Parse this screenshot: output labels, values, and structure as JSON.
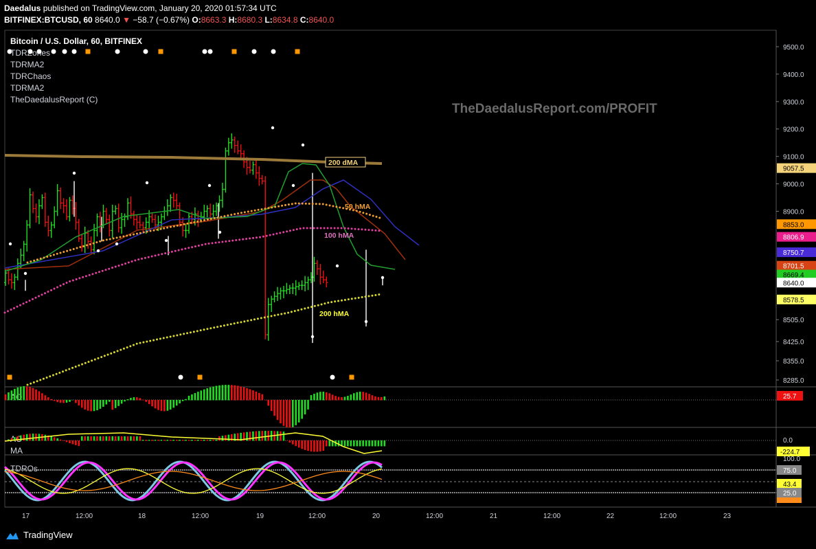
{
  "header": {
    "publisher": "Daedalus",
    "published_text": "published on TradingView.com, January 20, 2020 01:57:34 UTC",
    "symbol": "BITFINEX:BTCUSD, 60",
    "last": "8640.0",
    "change": "−58.7 (−0.67%)",
    "o_label": "O:",
    "o": "8663.3",
    "h_label": "H:",
    "h": "8680.3",
    "l_label": "L:",
    "l": "8634.8",
    "c_label": "C:",
    "c": "8640.0"
  },
  "legend": {
    "title": "Bitcoin / U.S. Dollar, 60, BITFINEX",
    "items": [
      "TDRZones",
      "TDRMA2",
      "TDRChaos",
      "TDRMA2",
      "TheDaedalusReport (C)"
    ]
  },
  "watermark": "TheDaedalusReport.com/PROFIT",
  "footer": {
    "brand": "TradingView"
  },
  "colors": {
    "up": "#22dd22",
    "down": "#ee1111",
    "ma200d": "#9c7a3a",
    "hma50": "#f0a030",
    "hma100": "#e040a0",
    "hma200": "#d8d830",
    "blue": "#3030c0",
    "green_ma": "#21a030",
    "brown_ma": "#a0300a"
  },
  "chart_data": [
    {
      "type": "line",
      "name": "price",
      "x_ticks": [
        "17",
        "12:00",
        "18",
        "12:00",
        "19",
        "12:00",
        "20",
        "12:00",
        "21",
        "12:00",
        "22",
        "12:00",
        "23"
      ],
      "y_ticks": [
        9500,
        9400,
        9300,
        9200,
        9100,
        9000,
        8900,
        8800,
        8700,
        8600,
        8505,
        8425,
        8355,
        8285
      ],
      "y_tick_labels": [
        "9500.0",
        "9400.0",
        "9300.0",
        "9200.0",
        "9100.0",
        "9000.0",
        "8900.0",
        "",
        "",
        "",
        "8505.0",
        "8425.0",
        "8355.0",
        "8285.0"
      ],
      "ylim": [
        8260,
        9560
      ],
      "price_tags": [
        {
          "label": "9057.5",
          "value": 9057.5,
          "color": "#f5d37a",
          "text": "#000"
        },
        {
          "label": "8853.0",
          "value": 8853.0,
          "color": "#ff9800",
          "text": "#000"
        },
        {
          "label": "8806.9",
          "value": 8806.9,
          "color": "#e91e8c",
          "text": "#fff"
        },
        {
          "label": "8750.7",
          "value": 8750.7,
          "color": "#4a2bd8",
          "text": "#fff"
        },
        {
          "label": "8701.5",
          "value": 8701.5,
          "color": "#d84315",
          "text": "#fff"
        },
        {
          "label": "8669.4",
          "value": 8669.4,
          "color": "#22cc22",
          "text": "#000"
        },
        {
          "label": "8640.0",
          "value": 8640.0,
          "color": "#ffffff",
          "text": "#000"
        },
        {
          "label": "8578.5",
          "value": 8578.5,
          "color": "#ffff66",
          "text": "#000"
        }
      ],
      "ma_labels": [
        {
          "text": "200 dMA",
          "value": 9057,
          "color": "#f5d37a"
        },
        {
          "text": "50 hMA",
          "value": 8903,
          "color": "#f0a030"
        },
        {
          "text": "100 hMA",
          "value": 8790,
          "color": "#e070c0"
        },
        {
          "text": "200 hMA",
          "value": 8520,
          "color": "#ffff33"
        }
      ]
    },
    {
      "type": "bar",
      "name": "AO",
      "label": "AO",
      "tag": {
        "label": "25.7",
        "color": "#ee1111",
        "text": "#fff"
      }
    },
    {
      "type": "bar",
      "name": "AO MA",
      "labels": [
        "AO",
        "MA"
      ],
      "y_tick_labels": [
        "0.0"
      ],
      "tag": {
        "label": "-224.7",
        "color": "#ffff33",
        "text": "#000"
      }
    },
    {
      "type": "line",
      "name": "TDROs",
      "label": "TDROs",
      "y_tick_labels": [
        "100.0"
      ],
      "tags": [
        {
          "label": "75.0",
          "color": "#888888",
          "text": "#fff"
        },
        {
          "label": "43.4",
          "color": "#ffff33",
          "text": "#000"
        },
        {
          "label": "25.0",
          "color": "#888888",
          "text": "#fff"
        }
      ]
    }
  ]
}
